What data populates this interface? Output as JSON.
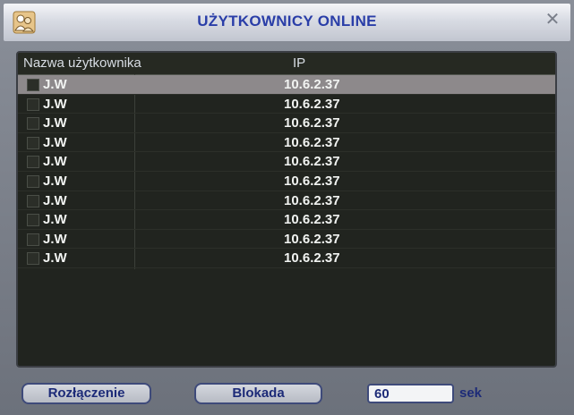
{
  "window": {
    "title": "UŻYTKOWNICY ONLINE",
    "close_symbol": "✕"
  },
  "table": {
    "columns": [
      "Nazwa użytkownika",
      "IP"
    ],
    "rows": [
      {
        "user": "J.W",
        "ip": "10.6.2.37",
        "selected": true
      },
      {
        "user": "J.W",
        "ip": "10.6.2.37"
      },
      {
        "user": "J.W",
        "ip": "10.6.2.37"
      },
      {
        "user": "J.W",
        "ip": "10.6.2.37"
      },
      {
        "user": "J.W",
        "ip": "10.6.2.37"
      },
      {
        "user": "J.W",
        "ip": "10.6.2.37"
      },
      {
        "user": "J.W",
        "ip": "10.6.2.37"
      },
      {
        "user": "J.W",
        "ip": "10.6.2.37"
      },
      {
        "user": "J.W",
        "ip": "10.6.2.37"
      },
      {
        "user": "J.W",
        "ip": "10.6.2.37"
      }
    ]
  },
  "footer": {
    "disconnect_label": "Rozłączenie",
    "block_label": "Blokada",
    "seconds_value": "60",
    "seconds_unit": "sek"
  },
  "icons": {
    "title_icon": "users-icon",
    "close_icon": "close-icon"
  }
}
